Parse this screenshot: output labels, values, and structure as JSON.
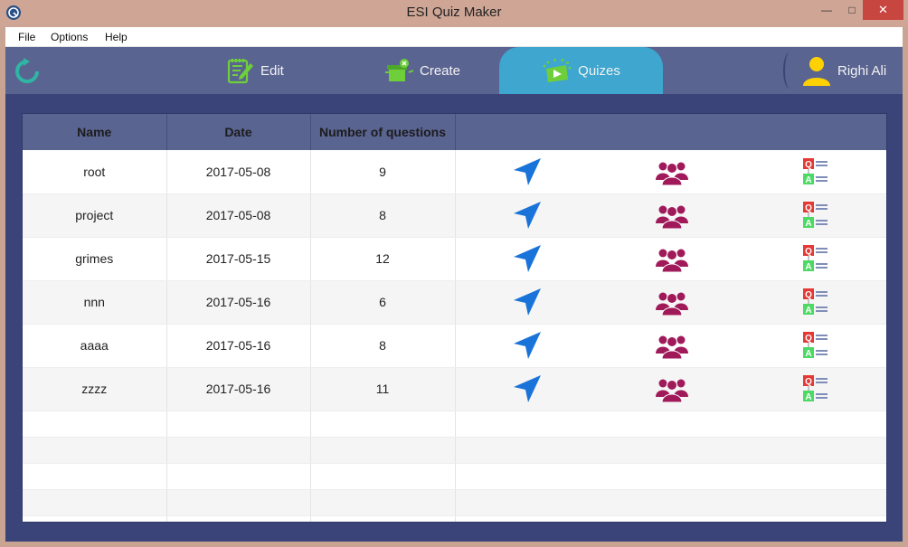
{
  "window": {
    "title": "ESI Quiz Maker"
  },
  "menu": {
    "items": [
      "File",
      "Options",
      "Help"
    ]
  },
  "nav": {
    "tabs": [
      {
        "label": "Edit",
        "icon": "edit-icon"
      },
      {
        "label": "Create",
        "icon": "create-icon"
      },
      {
        "label": "Quizes",
        "icon": "quizes-icon",
        "active": true
      }
    ],
    "user": {
      "name": "Righi Ali",
      "icon": "user-icon"
    }
  },
  "colors": {
    "nav_bg": "#5a6491",
    "active_tab": "#3ea6cf",
    "content_bg": "#3b4478",
    "send_icon": "#1a73d9",
    "group_icon": "#a01a5a"
  },
  "table": {
    "headers": [
      "Name",
      "Date",
      "Number of questions"
    ],
    "rows": [
      {
        "name": "root",
        "date": "2017-05-08",
        "questions": "9"
      },
      {
        "name": "project",
        "date": "2017-05-08",
        "questions": "8"
      },
      {
        "name": "grimes",
        "date": "2017-05-15",
        "questions": "12"
      },
      {
        "name": "nnn",
        "date": "2017-05-16",
        "questions": "6"
      },
      {
        "name": "aaaa",
        "date": "2017-05-16",
        "questions": "8"
      },
      {
        "name": "zzzz",
        "date": "2017-05-16",
        "questions": "11"
      }
    ]
  }
}
